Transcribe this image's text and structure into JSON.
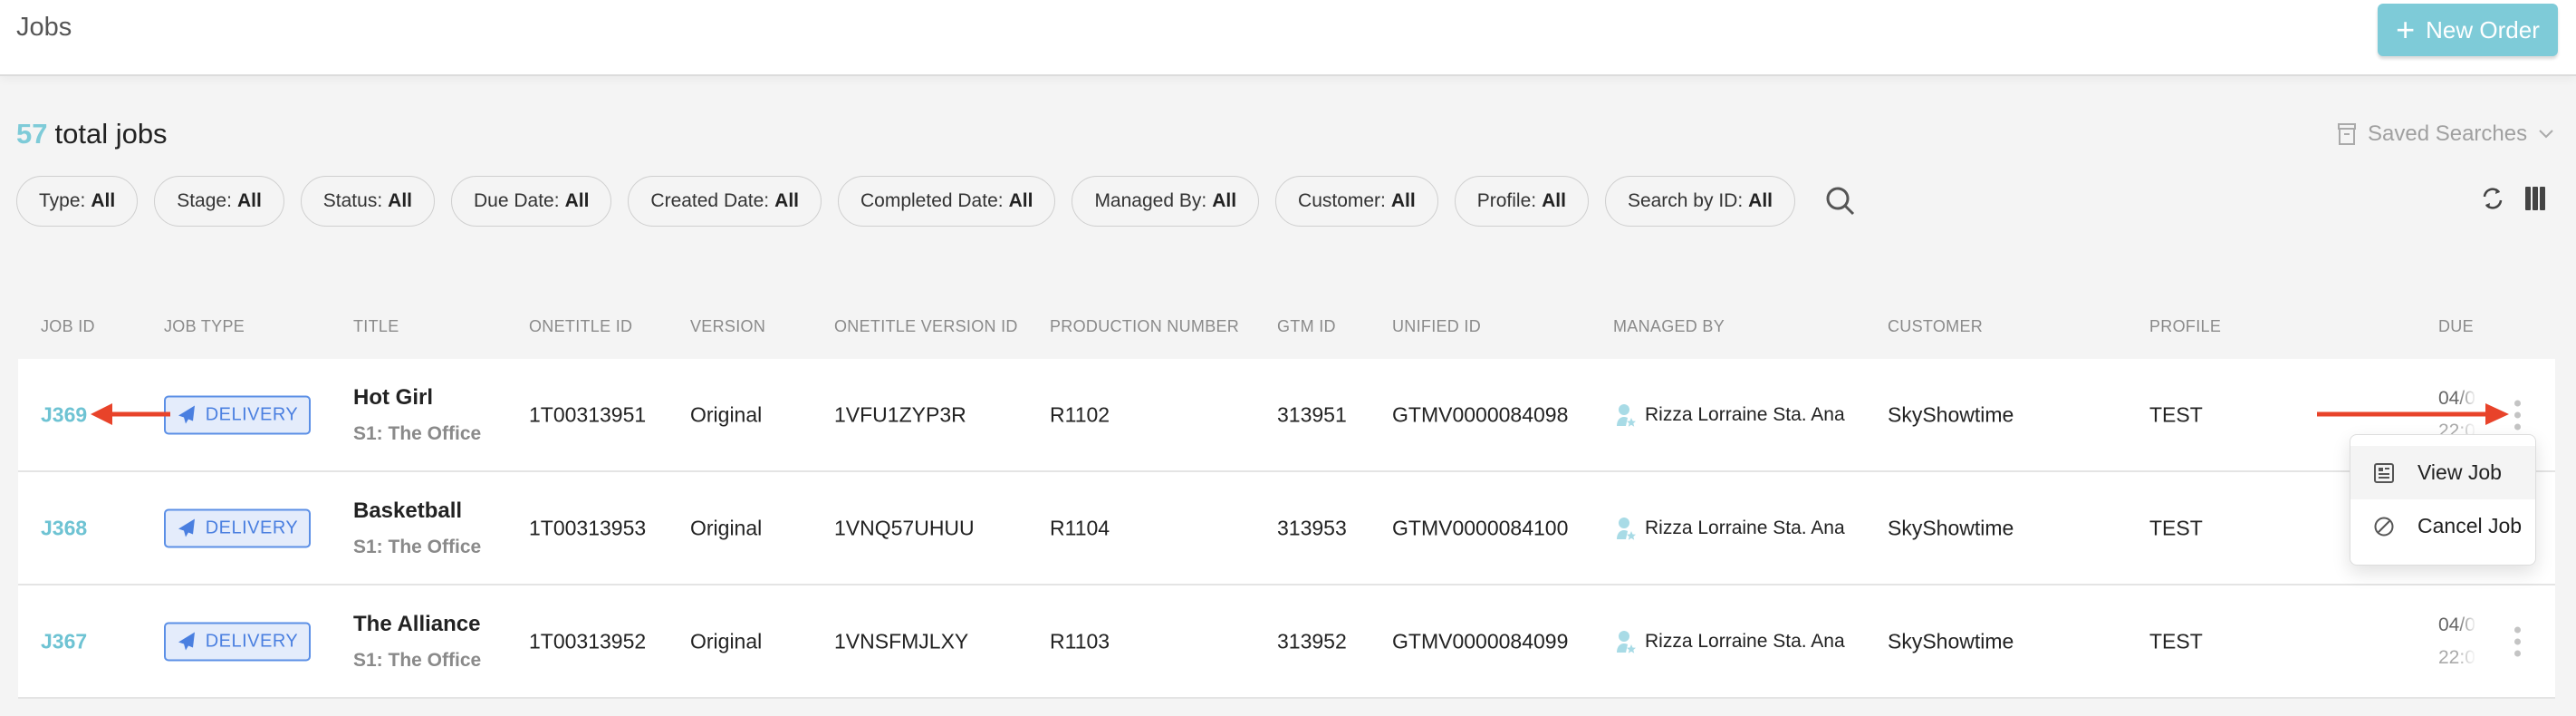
{
  "header": {
    "title": "Jobs",
    "new_order_label": "New Order",
    "new_order_icon": "plus-icon"
  },
  "summary": {
    "count": "57",
    "label": "total jobs"
  },
  "saved_searches": {
    "label": "Saved Searches",
    "icon": "archive-icon"
  },
  "filters": [
    {
      "label": "Type:",
      "value": "All"
    },
    {
      "label": "Stage:",
      "value": "All"
    },
    {
      "label": "Status:",
      "value": "All"
    },
    {
      "label": "Due Date:",
      "value": "All"
    },
    {
      "label": "Created Date:",
      "value": "All"
    },
    {
      "label": "Completed Date:",
      "value": "All"
    },
    {
      "label": "Managed By:",
      "value": "All"
    },
    {
      "label": "Customer:",
      "value": "All"
    },
    {
      "label": "Profile:",
      "value": "All"
    },
    {
      "label": "Search by ID:",
      "value": "All"
    }
  ],
  "table": {
    "columns": [
      "JOB ID",
      "JOB TYPE",
      "TITLE",
      "ONETITLE ID",
      "VERSION",
      "ONETITLE VERSION ID",
      "PRODUCTION NUMBER",
      "GTM ID",
      "UNIFIED ID",
      "MANAGED BY",
      "CUSTOMER",
      "PROFILE",
      "DUE"
    ],
    "rows": [
      {
        "job_id": "J369",
        "job_type": "DELIVERY",
        "title": "Hot Girl",
        "subtitle": "S1: The Office",
        "onetitle_id": "1T00313951",
        "version": "Original",
        "onetitle_version_id": "1VFU1ZYP3R",
        "production_number": "R1102",
        "gtm_id": "313951",
        "unified_id": "GTMV0000084098",
        "managed_by": "Rizza Lorraine Sta. Ana",
        "customer": "SkyShowtime",
        "profile": "TEST",
        "due_date": "04/0",
        "due_time": "22:0"
      },
      {
        "job_id": "J368",
        "job_type": "DELIVERY",
        "title": "Basketball",
        "subtitle": "S1: The Office",
        "onetitle_id": "1T00313953",
        "version": "Original",
        "onetitle_version_id": "1VNQ57UHUU",
        "production_number": "R1104",
        "gtm_id": "313953",
        "unified_id": "GTMV0000084100",
        "managed_by": "Rizza Lorraine Sta. Ana",
        "customer": "SkyShowtime",
        "profile": "TEST",
        "due_date": "",
        "due_time": ""
      },
      {
        "job_id": "J367",
        "job_type": "DELIVERY",
        "title": "The Alliance",
        "subtitle": "S1: The Office",
        "onetitle_id": "1T00313952",
        "version": "Original",
        "onetitle_version_id": "1VNSFMJLXY",
        "production_number": "R1103",
        "gtm_id": "313952",
        "unified_id": "GTMV0000084099",
        "managed_by": "Rizza Lorraine Sta. Ana",
        "customer": "SkyShowtime",
        "profile": "TEST",
        "due_date": "04/0",
        "due_time": "22:0"
      }
    ]
  },
  "context_menu": {
    "items": [
      {
        "label": "View Job",
        "icon": "document-icon"
      },
      {
        "label": "Cancel Job",
        "icon": "cancel-icon"
      }
    ]
  },
  "colors": {
    "accent": "#7ecbd8",
    "badge": "#4a7fe0",
    "annotation_arrow": "#e8432a"
  }
}
